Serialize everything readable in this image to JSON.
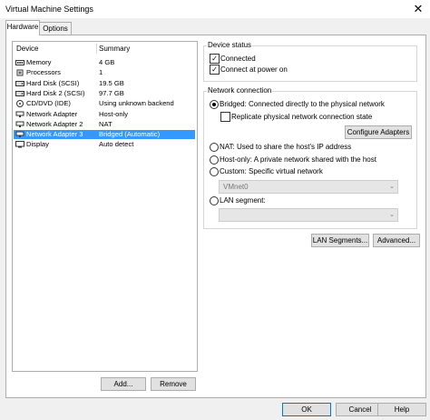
{
  "window": {
    "title": "Virtual Machine Settings",
    "close_glyph": "✕"
  },
  "tabs": [
    {
      "label": "Hardware",
      "active": true
    },
    {
      "label": "Options",
      "active": false
    }
  ],
  "device_list": {
    "headers": {
      "device": "Device",
      "summary": "Summary"
    },
    "rows": [
      {
        "icon": "memory-icon",
        "device": "Memory",
        "summary": "4 GB",
        "selected": false
      },
      {
        "icon": "processor-icon",
        "device": "Processors",
        "summary": "1",
        "selected": false
      },
      {
        "icon": "hard-disk-icon",
        "device": "Hard Disk (SCSI)",
        "summary": "19.5 GB",
        "selected": false
      },
      {
        "icon": "hard-disk-icon",
        "device": "Hard Disk 2 (SCSI)",
        "summary": "97.7 GB",
        "selected": false
      },
      {
        "icon": "cd-dvd-icon",
        "device": "CD/DVD (IDE)",
        "summary": "Using unknown backend",
        "selected": false
      },
      {
        "icon": "network-adapter-icon",
        "device": "Network Adapter",
        "summary": "Host-only",
        "selected": false
      },
      {
        "icon": "network-adapter-icon",
        "device": "Network Adapter 2",
        "summary": "NAT",
        "selected": false
      },
      {
        "icon": "network-adapter-icon",
        "device": "Network Adapter 3",
        "summary": "Bridged (Automatic)",
        "selected": true
      },
      {
        "icon": "display-icon",
        "device": "Display",
        "summary": "Auto detect",
        "selected": false
      }
    ],
    "add_button": "Add...",
    "remove_button": "Remove"
  },
  "device_status": {
    "title": "Device status",
    "connected": {
      "label": "Connected",
      "checked": true
    },
    "connect_at_power_on": {
      "label": "Connect at power on",
      "checked": true
    }
  },
  "network_connection": {
    "title": "Network connection",
    "bridged": {
      "label": "Bridged: Connected directly to the physical network",
      "selected": true
    },
    "replicate": {
      "label": "Replicate physical network connection state",
      "checked": false
    },
    "configure_adapters": "Configure Adapters",
    "nat": {
      "label": "NAT: Used to share the host's IP address",
      "selected": false
    },
    "host_only": {
      "label": "Host-only: A private network shared with the host",
      "selected": false
    },
    "custom": {
      "label": "Custom: Specific virtual network",
      "selected": false
    },
    "custom_select_value": "VMnet0",
    "lan_segment": {
      "label": "LAN segment:",
      "selected": false
    },
    "lan_select_value": ""
  },
  "buttons": {
    "lan_segments": "LAN Segments...",
    "advanced": "Advanced...",
    "ok": "OK",
    "cancel": "Cancel",
    "help": "Help"
  },
  "colors": {
    "selection": "#3399ff",
    "primary_border": "#0078d7"
  }
}
